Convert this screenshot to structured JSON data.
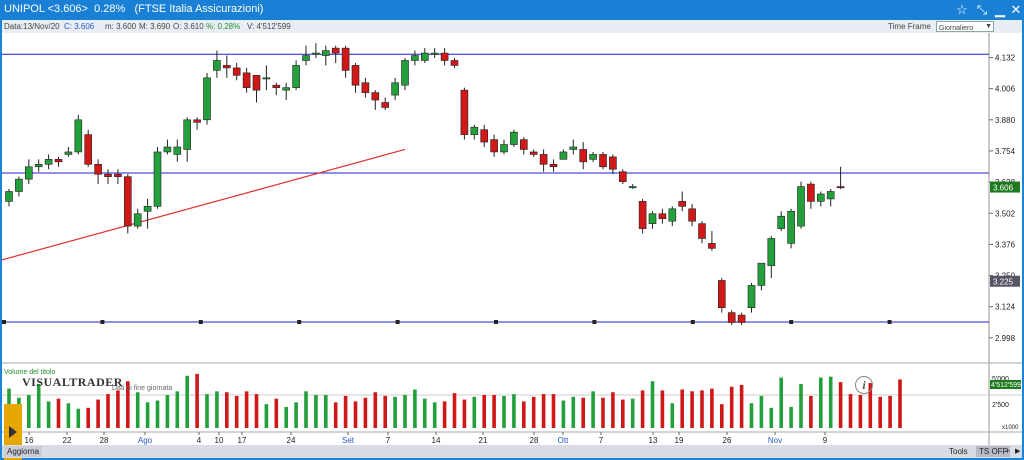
{
  "window": {
    "title": "UNIPOL <3.606>  0.28%   (FTSE Italia Assicurazioni)"
  },
  "infobar": {
    "date": "Data:13/Nov/20",
    "close": "C: 3.606",
    "min": "m: 3.600",
    "max": "M: 3.690",
    "open": "O: 3.610",
    "pct": "%: 0.28%",
    "volume": "V: 4'512'599",
    "timeframe_label": "Time Frame",
    "timeframe_value": "Giornaliero"
  },
  "branding": {
    "logo": "VISUALTRADER",
    "subtitle": "Dati di fine giornata"
  },
  "bottombar": {
    "refresh": "Aggiorna",
    "tools": "Tools",
    "ts": "TS OFF"
  },
  "colors": {
    "up": "#23a03c",
    "down": "#d01818",
    "hline": "#2020d0",
    "trend": "#e03030",
    "last": "#1e7a1e"
  },
  "chart_data": {
    "type": "candlestick",
    "title": "",
    "price_axis": {
      "ticks": [
        2.998,
        3.124,
        3.25,
        3.376,
        3.502,
        3.628,
        3.754,
        3.88,
        4.006,
        4.132
      ],
      "range": [
        2.965,
        4.215
      ]
    },
    "last_price_label": "3.606",
    "level_label": "3.225",
    "volume_label": "Volume del titolo",
    "volume_axis": {
      "ticks": [
        "5'000",
        "2'500"
      ],
      "current": "4'512'599",
      "multiplier": "x1000"
    },
    "x_tick_labels": [
      "16",
      "22",
      "28",
      "Ago",
      "4",
      "10",
      "17",
      "24",
      "Set",
      "7",
      "14",
      "21",
      "28",
      "Ott",
      "7",
      "13",
      "19",
      "26",
      "Nov",
      "9"
    ],
    "horizontal_lines": [
      4.145,
      3.665,
      3.062
    ],
    "trendline": {
      "from": [
        0,
        3.31
      ],
      "to": [
        40,
        3.76
      ]
    },
    "candles": [
      [
        3.55,
        3.59,
        3.53,
        3.6
      ],
      [
        3.59,
        3.64,
        3.57,
        3.65
      ],
      [
        3.64,
        3.69,
        3.62,
        3.72
      ],
      [
        3.69,
        3.7,
        3.67,
        3.72
      ],
      [
        3.7,
        3.72,
        3.68,
        3.74
      ],
      [
        3.72,
        3.71,
        3.69,
        3.73
      ],
      [
        3.74,
        3.75,
        3.73,
        3.77
      ],
      [
        3.75,
        3.88,
        3.74,
        3.9
      ],
      [
        3.82,
        3.7,
        3.69,
        3.84
      ],
      [
        3.7,
        3.66,
        3.62,
        3.72
      ],
      [
        3.66,
        3.65,
        3.62,
        3.68
      ],
      [
        3.66,
        3.65,
        3.62,
        3.68
      ],
      [
        3.65,
        3.45,
        3.42,
        3.66
      ],
      [
        3.45,
        3.5,
        3.44,
        3.52
      ],
      [
        3.51,
        3.53,
        3.44,
        3.56
      ],
      [
        3.53,
        3.75,
        3.52,
        3.77
      ],
      [
        3.75,
        3.77,
        3.74,
        3.8
      ],
      [
        3.74,
        3.77,
        3.71,
        3.8
      ],
      [
        3.76,
        3.88,
        3.71,
        3.89
      ],
      [
        3.88,
        3.87,
        3.84,
        3.89
      ],
      [
        3.88,
        4.05,
        3.86,
        4.07
      ],
      [
        4.08,
        4.12,
        4.05,
        4.16
      ],
      [
        4.1,
        4.09,
        4.05,
        4.14
      ],
      [
        4.09,
        4.06,
        4.04,
        4.11
      ],
      [
        4.07,
        4.01,
        3.99,
        4.09
      ],
      [
        4.06,
        4.0,
        3.95,
        4.06
      ],
      [
        4.05,
        4.05,
        4.0,
        4.1
      ],
      [
        4.02,
        4.01,
        3.98,
        4.03
      ],
      [
        4.0,
        4.01,
        3.96,
        4.03
      ],
      [
        4.01,
        4.1,
        4.0,
        4.12
      ],
      [
        4.12,
        4.14,
        4.1,
        4.18
      ],
      [
        4.15,
        4.15,
        4.13,
        4.19
      ],
      [
        4.14,
        4.16,
        4.1,
        4.18
      ],
      [
        4.17,
        4.15,
        4.11,
        4.18
      ],
      [
        4.17,
        4.08,
        4.05,
        4.18
      ],
      [
        4.1,
        4.02,
        3.99,
        4.11
      ],
      [
        4.03,
        3.99,
        3.97,
        4.05
      ],
      [
        3.99,
        3.96,
        3.92,
        4.0
      ],
      [
        3.95,
        3.93,
        3.92,
        3.97
      ],
      [
        3.98,
        4.03,
        3.96,
        4.05
      ],
      [
        4.02,
        4.12,
        4.0,
        4.13
      ],
      [
        4.12,
        4.14,
        4.1,
        4.16
      ],
      [
        4.12,
        4.15,
        4.11,
        4.17
      ],
      [
        4.15,
        4.15,
        4.13,
        4.17
      ],
      [
        4.15,
        4.12,
        4.1,
        4.17
      ],
      [
        4.12,
        4.1,
        4.09,
        4.13
      ],
      [
        4.0,
        3.82,
        3.8,
        4.01
      ],
      [
        3.82,
        3.85,
        3.8,
        3.86
      ],
      [
        3.84,
        3.79,
        3.77,
        3.86
      ],
      [
        3.8,
        3.75,
        3.73,
        3.82
      ],
      [
        3.75,
        3.78,
        3.74,
        3.8
      ],
      [
        3.78,
        3.83,
        3.77,
        3.84
      ],
      [
        3.8,
        3.76,
        3.74,
        3.81
      ],
      [
        3.75,
        3.74,
        3.73,
        3.76
      ],
      [
        3.74,
        3.7,
        3.67,
        3.76
      ],
      [
        3.7,
        3.69,
        3.67,
        3.72
      ],
      [
        3.72,
        3.75,
        3.72,
        3.76
      ],
      [
        3.76,
        3.77,
        3.74,
        3.8
      ],
      [
        3.76,
        3.71,
        3.68,
        3.79
      ],
      [
        3.72,
        3.74,
        3.71,
        3.75
      ],
      [
        3.74,
        3.69,
        3.68,
        3.75
      ],
      [
        3.73,
        3.68,
        3.66,
        3.74
      ],
      [
        3.67,
        3.63,
        3.62,
        3.68
      ],
      [
        3.61,
        3.61,
        3.6,
        3.62
      ],
      [
        3.55,
        3.44,
        3.42,
        3.56
      ],
      [
        3.46,
        3.5,
        3.44,
        3.51
      ],
      [
        3.5,
        3.48,
        3.46,
        3.52
      ],
      [
        3.47,
        3.52,
        3.45,
        3.53
      ],
      [
        3.55,
        3.53,
        3.51,
        3.59
      ],
      [
        3.52,
        3.47,
        3.45,
        3.54
      ],
      [
        3.46,
        3.4,
        3.38,
        3.47
      ],
      [
        3.38,
        3.36,
        3.35,
        3.43
      ],
      [
        3.23,
        3.12,
        3.1,
        3.24
      ],
      [
        3.1,
        3.06,
        3.05,
        3.11
      ],
      [
        3.09,
        3.06,
        3.05,
        3.1
      ],
      [
        3.12,
        3.21,
        3.1,
        3.22
      ],
      [
        3.21,
        3.3,
        3.19,
        3.3
      ],
      [
        3.29,
        3.4,
        3.24,
        3.41
      ],
      [
        3.44,
        3.49,
        3.43,
        3.51
      ],
      [
        3.38,
        3.51,
        3.36,
        3.52
      ],
      [
        3.45,
        3.61,
        3.44,
        3.63
      ],
      [
        3.62,
        3.55,
        3.52,
        3.63
      ],
      [
        3.55,
        3.58,
        3.53,
        3.59
      ],
      [
        3.56,
        3.59,
        3.53,
        3.6
      ],
      [
        3.61,
        3.606,
        3.6,
        3.69
      ]
    ],
    "volumes": [
      4300,
      3300,
      3600,
      4800,
      2900,
      3200,
      2700,
      2100,
      2200,
      3100,
      3700,
      4100,
      5100,
      3900,
      2800,
      3000,
      3600,
      4000,
      5700,
      5900,
      3700,
      4000,
      3900,
      3500,
      4000,
      3700,
      2600,
      3200,
      2300,
      2800,
      4000,
      3600,
      3600,
      2800,
      3500,
      2900,
      3300,
      3900,
      3500,
      3400,
      3600,
      4200,
      3200,
      2800,
      2900,
      3800,
      3100,
      3400,
      3600,
      3600,
      3500,
      3700,
      2900,
      3400,
      3700,
      3700,
      3000,
      3400,
      3300,
      4000,
      3300,
      3900,
      3100,
      3200,
      4100,
      5100,
      4100,
      2700,
      4200,
      4000,
      4100,
      4300,
      2600,
      4500,
      4700,
      2700,
      3500,
      2200,
      5500,
      2300,
      4800,
      3500,
      5500,
      5600,
      5000,
      3700,
      3600,
      4900,
      3400,
      3500,
      5300
    ]
  }
}
